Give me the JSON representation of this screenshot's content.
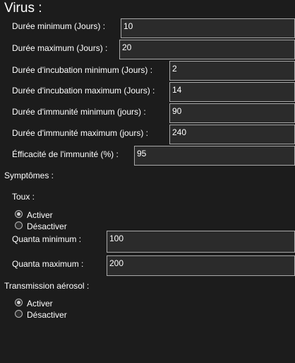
{
  "virus": {
    "heading": "Virus :",
    "fields": [
      {
        "label": "Durée minimum (Jours) :",
        "value": "10"
      },
      {
        "label": "Durée maximum (Jours) :",
        "value": "20"
      },
      {
        "label": "Durée d'incubation minimum (Jours) :",
        "value": "2"
      },
      {
        "label": "Durée d'incubation maximum (Jours) :",
        "value": "14"
      },
      {
        "label": "Durée d'immunité minimum (jours) :",
        "value": "90"
      },
      {
        "label": "Durée d'immunité maximum (jours) :",
        "value": "240"
      },
      {
        "label": "Éfficacité de l'immunité (%) :",
        "value": "95"
      }
    ]
  },
  "symptoms": {
    "heading": "Symptômes :",
    "cough": {
      "heading": "Toux :",
      "options": [
        "Activer",
        "Désactiver"
      ],
      "selected": "Activer",
      "fields": [
        {
          "label": "Quanta minimum :",
          "value": "100"
        },
        {
          "label": "Quanta maximum :",
          "value": "200"
        }
      ]
    }
  },
  "aerosol": {
    "heading": "Transmission aérosol :",
    "options": [
      "Activer",
      "Désactiver"
    ],
    "selected": "Activer"
  }
}
